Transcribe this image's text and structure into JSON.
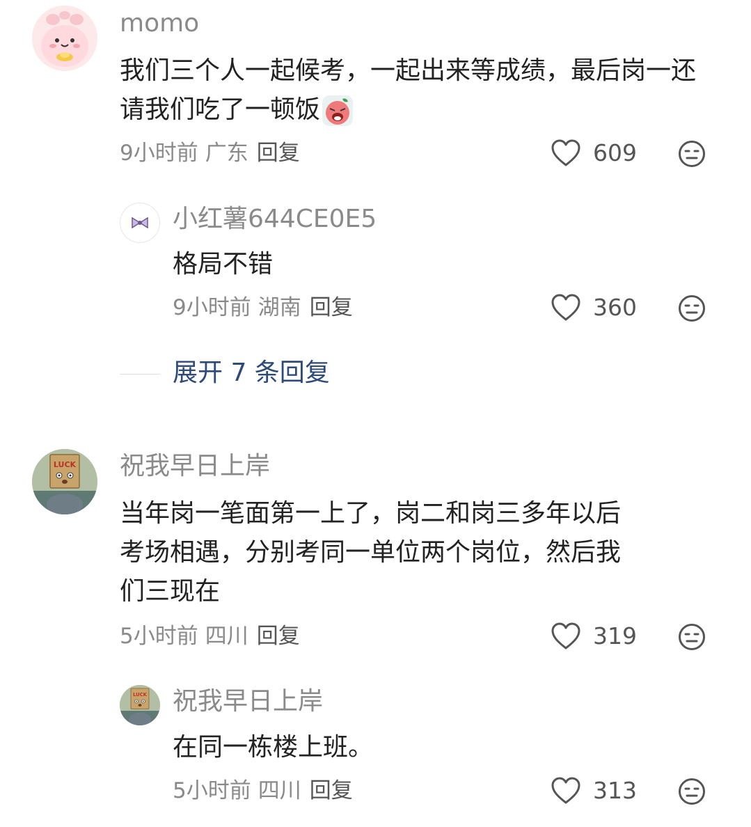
{
  "comments": [
    {
      "user": "momo",
      "text": "我们三个人一起候考，一起出来等成绩，最后岗一还请我们吃了一顿饭",
      "time": "9小时前",
      "location": "广东",
      "reply": "回复",
      "likes": "609",
      "avatar_icon": "pink-cartoon-avatar-icon",
      "emoji_icon": "crying-emoji-icon",
      "replies": [
        {
          "user": "小红薯644CE0E5",
          "text": "格局不错",
          "time": "9小时前",
          "location": "湖南",
          "reply": "回复",
          "likes": "360",
          "avatar_icon": "bow-avatar-icon"
        }
      ],
      "expand": "展开 7 条回复"
    },
    {
      "user": "祝我早日上岸",
      "text_lines": [
        "当年岗一笔面第一上了，岗二和岗三多年以后",
        "考场相遇，分别考同一单位两个岗位，然后我",
        "们三现在"
      ],
      "time": "5小时前",
      "location": "四川",
      "reply": "回复",
      "likes": "319",
      "avatar_icon": "luck-cat-avatar-icon",
      "replies": [
        {
          "user": "祝我早日上岸",
          "text": "在同一栋楼上班。",
          "time": "5小时前",
          "location": "四川",
          "reply": "回复",
          "likes": "313",
          "avatar_icon": "luck-cat-avatar-icon"
        }
      ]
    }
  ],
  "colors": {
    "name": "#8a8a8a",
    "text": "#222222",
    "link": "#2c4a7a"
  }
}
